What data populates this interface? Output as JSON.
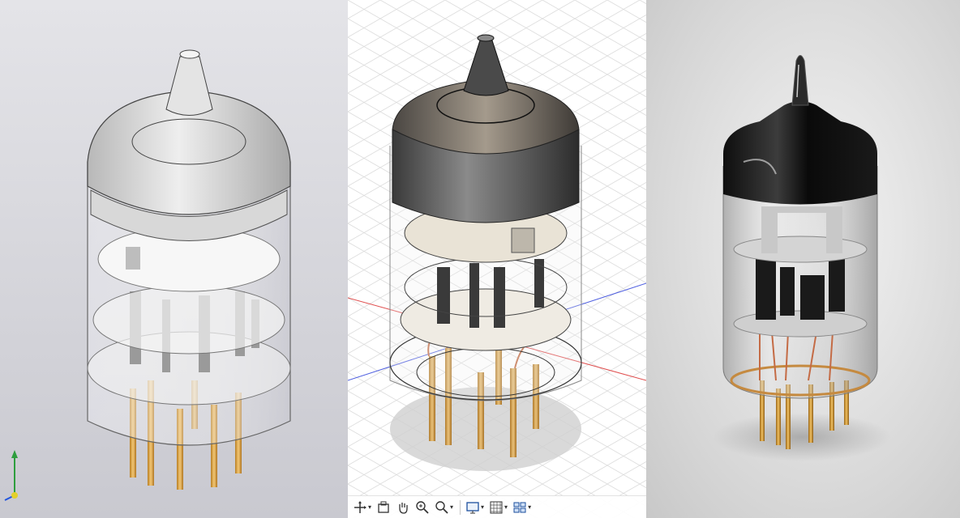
{
  "panels": [
    {
      "id": "kompas",
      "description_icon": "vacuum-tube-render"
    },
    {
      "id": "fusion",
      "description_icon": "vacuum-tube-render"
    },
    {
      "id": "render",
      "description_icon": "vacuum-tube-render"
    }
  ],
  "toolbar": {
    "icons": [
      "orbit-icon",
      "look-at-icon",
      "pan-hand-icon",
      "zoom-window-icon",
      "fit-zoom-icon",
      "display-settings-icon",
      "grid-settings-icon",
      "viewports-icon"
    ]
  },
  "axis_triad": {
    "icons": [
      "y-axis-icon",
      "x-axis-icon",
      "z-axis-icon"
    ]
  },
  "colors": {
    "pins": "#d9a441",
    "fusion_red_axis": "#e05050",
    "fusion_blue_axis": "#5060e0",
    "kompas_bg": "#d2d2d8"
  }
}
